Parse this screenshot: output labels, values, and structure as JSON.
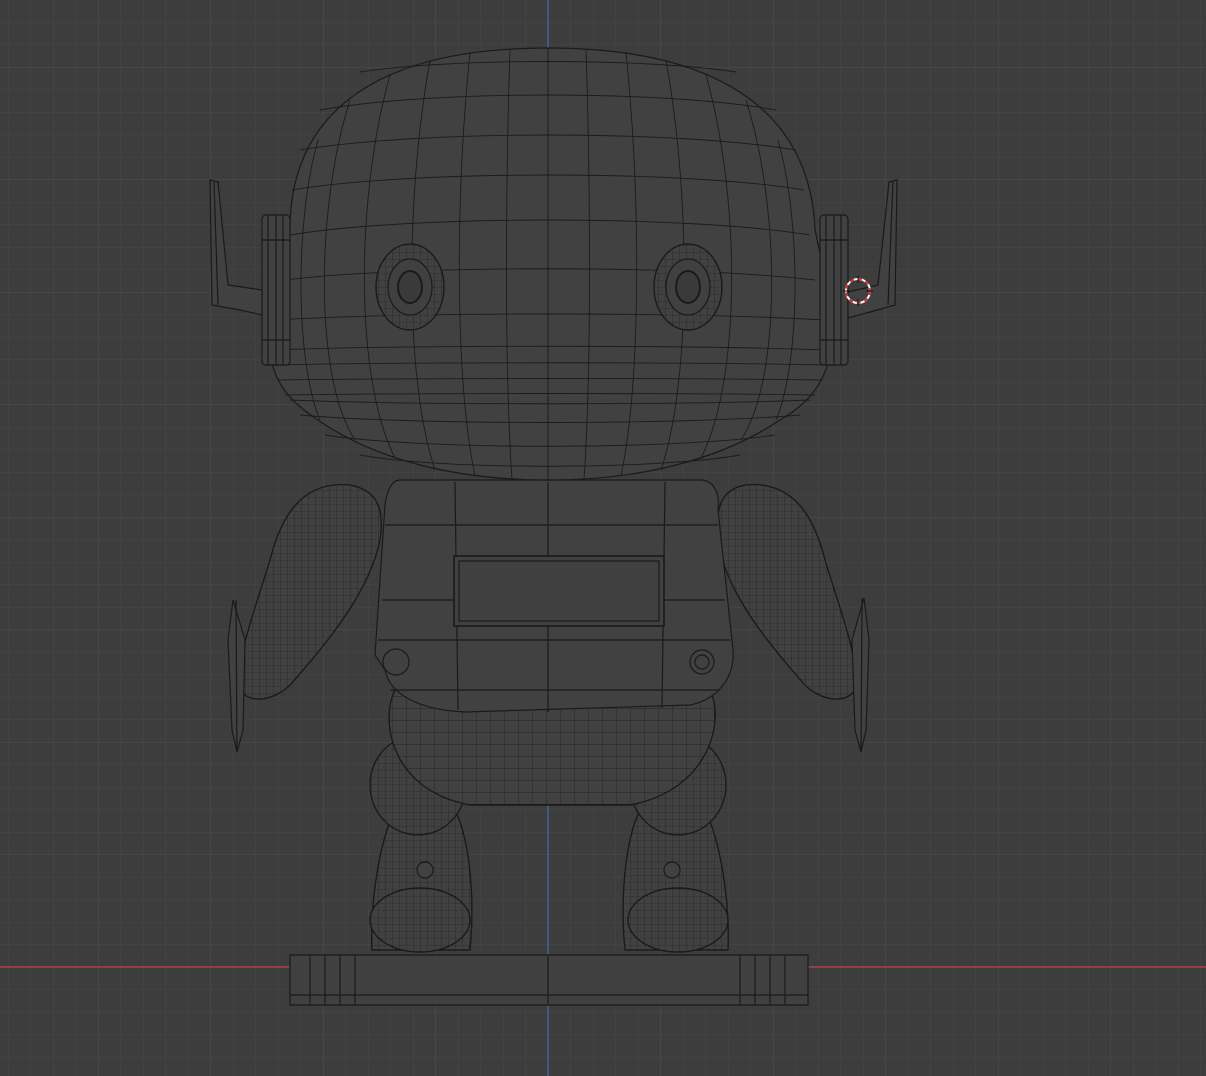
{
  "viewport": {
    "view": "front-orthographic",
    "shading": "wireframe",
    "model": "robot-character",
    "colors": {
      "background": "#3d3d3d",
      "grid_minor": "#464646",
      "grid_major": "#525252",
      "x_axis": "#c1404f",
      "z_axis": "#3e6fb5",
      "wire": "#1a1a1a",
      "surface": "#414141",
      "cursor_red": "#e32a2a",
      "cursor_white": "#ffffff"
    }
  }
}
